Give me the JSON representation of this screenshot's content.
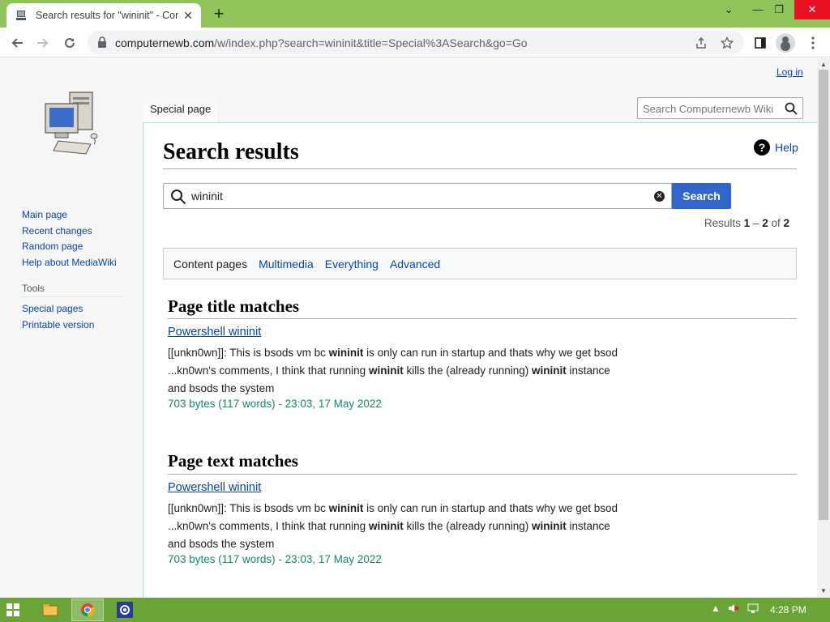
{
  "browser": {
    "tab_title": "Search results for \"wininit\" - Computernewb Wiki",
    "new_tab_label": "+",
    "url_host": "computernewb.com",
    "url_path": "/w/index.php?search=wininit&title=Special%3ASearch&go=Go",
    "window_controls": {
      "minimize": "—",
      "restore": "❐",
      "close": "✕",
      "tab_list": "⌄"
    }
  },
  "wiki": {
    "login_label": "Log in",
    "page_tab_label": "Special page",
    "search_placeholder": "Search Computernewb Wiki",
    "sidebar": {
      "navigation": [
        "Main page",
        "Recent changes",
        "Random page",
        "Help about MediaWiki"
      ],
      "tools_heading": "Tools",
      "tools": [
        "Special pages",
        "Printable version"
      ]
    },
    "heading": "Search results",
    "help_label": "Help",
    "query_value": "wininit",
    "search_button_label": "Search",
    "results_info": {
      "prefix": "Results ",
      "range_start": "1",
      "dash": " – ",
      "range_end": "2",
      "of": " of ",
      "total": "2"
    },
    "profiles": [
      "Content pages",
      "Multimedia",
      "Everything",
      "Advanced"
    ],
    "active_profile": "Content pages",
    "sections": [
      {
        "title": "Page title matches",
        "result": {
          "title": "Powershell wininit",
          "snippet": [
            {
              "t": "[[unkn0wn]]: This is bsods vm bc ",
              "b": false
            },
            {
              "t": "wininit",
              "b": true
            },
            {
              "t": " is only can run in startup and thats why we get bsod ...kn0wn's comments, I think that running ",
              "b": false
            },
            {
              "t": "wininit",
              "b": true
            },
            {
              "t": " kills the (already running) ",
              "b": false
            },
            {
              "t": "wininit",
              "b": true
            },
            {
              "t": " instance and bsods the system",
              "b": false
            }
          ],
          "meta": "703 bytes (117 words) - 23:03, 17 May 2022"
        }
      },
      {
        "title": "Page text matches",
        "result": {
          "title": "Powershell wininit",
          "snippet": [
            {
              "t": "[[unkn0wn]]: This is bsods vm bc ",
              "b": false
            },
            {
              "t": "wininit",
              "b": true
            },
            {
              "t": " is only can run in startup and thats why we get bsod ...kn0wn's comments, I think that running ",
              "b": false
            },
            {
              "t": "wininit",
              "b": true
            },
            {
              "t": " kills the (already running) ",
              "b": false
            },
            {
              "t": "wininit",
              "b": true
            },
            {
              "t": " instance and bsods the system",
              "b": false
            }
          ],
          "meta": "703 bytes (117 words) - 23:03, 17 May 2022"
        }
      }
    ]
  },
  "taskbar": {
    "clock": "4:28 PM",
    "apps": [
      "file-explorer-icon",
      "chrome-icon",
      "settings-app-icon"
    ]
  },
  "colors": {
    "link": "#0645ad",
    "meta_green": "#14866d",
    "search_button": "#3366cc",
    "taskbar": "#6aa437",
    "tabstrip": "#8fc45a"
  }
}
